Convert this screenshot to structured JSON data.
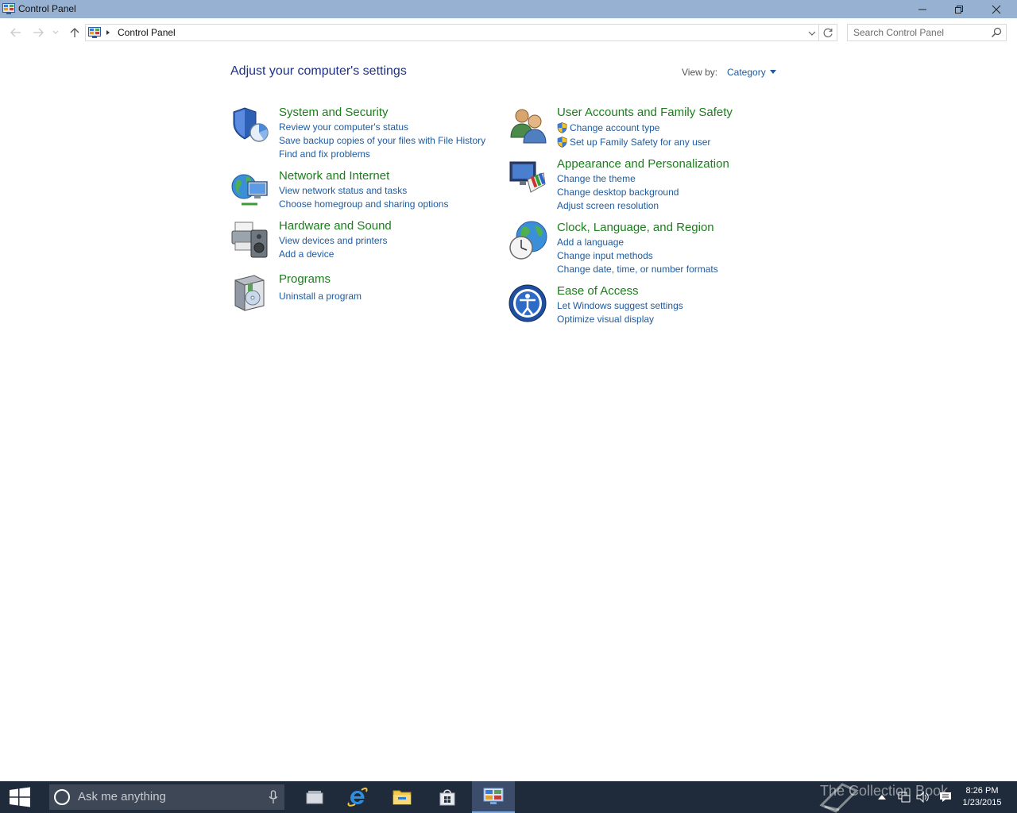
{
  "window": {
    "title": "Control Panel",
    "buttons": {
      "minimize": "minimize",
      "restore": "restore",
      "close": "close"
    }
  },
  "address": {
    "breadcrumb": "Control Panel",
    "search_placeholder": "Search Control Panel"
  },
  "main": {
    "heading": "Adjust your computer's settings",
    "view_by_label": "View by:",
    "view_by_value": "Category",
    "left_categories": [
      {
        "title": "System and Security",
        "icon": "shield-icon",
        "links": [
          "Review your computer's status",
          "Save backup copies of your files with File History",
          "Find and fix problems"
        ]
      },
      {
        "title": "Network and Internet",
        "icon": "network-globe-icon",
        "links": [
          "View network status and tasks",
          "Choose homegroup and sharing options"
        ]
      },
      {
        "title": "Hardware and Sound",
        "icon": "printer-speaker-icon",
        "links": [
          "View devices and printers",
          "Add a device"
        ]
      },
      {
        "title": "Programs",
        "icon": "programs-box-icon",
        "links": [
          "Uninstall a program"
        ]
      }
    ],
    "right_categories": [
      {
        "title": "User Accounts and Family Safety",
        "icon": "users-icon",
        "links": [
          "Change account type",
          "Set up Family Safety for any user"
        ]
      },
      {
        "title": "Appearance and Personalization",
        "icon": "monitor-palette-icon",
        "links": [
          "Change the theme",
          "Change desktop background",
          "Adjust screen resolution"
        ]
      },
      {
        "title": "Clock, Language, and Region",
        "icon": "clock-globe-icon",
        "links": [
          "Add a language",
          "Change input methods",
          "Change date, time, or number formats"
        ]
      },
      {
        "title": "Ease of Access",
        "icon": "ease-of-access-icon",
        "links": [
          "Let Windows suggest settings",
          "Optimize visual display"
        ]
      }
    ]
  },
  "taskbar": {
    "search_placeholder": "Ask me anything",
    "watermark": "The Collection Book",
    "time": "8:26 PM",
    "date": "1/23/2015"
  },
  "colors": {
    "category_title": "#1c7d1c",
    "link": "#1e5a9e",
    "heading": "#1e3287",
    "titlebar": "#97b1d2",
    "taskbar": "#1f2a3a"
  }
}
